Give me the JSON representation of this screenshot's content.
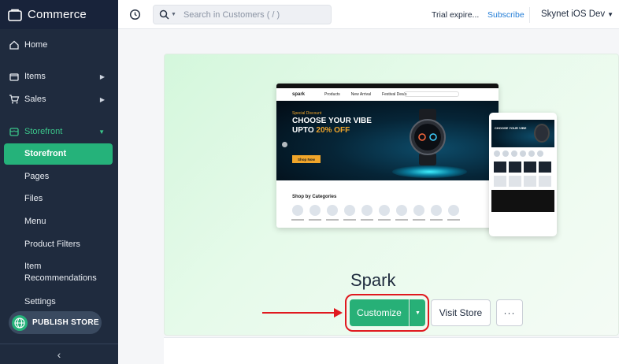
{
  "app": {
    "title": "Commerce"
  },
  "sidebar": {
    "items": [
      {
        "label": "Home",
        "icon": "home-icon"
      },
      {
        "label": "Items",
        "icon": "box-icon"
      },
      {
        "label": "Sales",
        "icon": "cart-icon"
      },
      {
        "label": "Storefront",
        "icon": "store-icon"
      }
    ],
    "storefront_sub": [
      "Storefront",
      "Pages",
      "Files",
      "Menu",
      "Product Filters",
      "Item Recommendations",
      "Settings"
    ],
    "publish_label": "PUBLISH STORE",
    "collapse_icon": "chevron-left-icon"
  },
  "header": {
    "search_placeholder": "Search in Customers ( / )",
    "trial_text": "Trial expire...",
    "subscribe_label": "Subscribe",
    "org_name": "Skynet iOS Dev"
  },
  "preview": {
    "brand": "spark",
    "nav_products": "Products",
    "nav_new": "New Arrival",
    "nav_deals": "Festival Deals",
    "promo_tag": "Special Discount",
    "headline_1": "CHOOSE YOUR VIBE",
    "headline_2": "UPTO",
    "headline_highlight": "20% OFF",
    "shop_now": "Shop Now",
    "categories_title": "Shop by Categories"
  },
  "store": {
    "name": "Spark",
    "customize_label": "Customize",
    "visit_label": "Visit Store",
    "more_label": "···"
  },
  "colors": {
    "sidebar_bg": "#1f2b3e",
    "accent": "#27b077",
    "highlight": "#e0191f",
    "link": "#1f7bd6"
  }
}
